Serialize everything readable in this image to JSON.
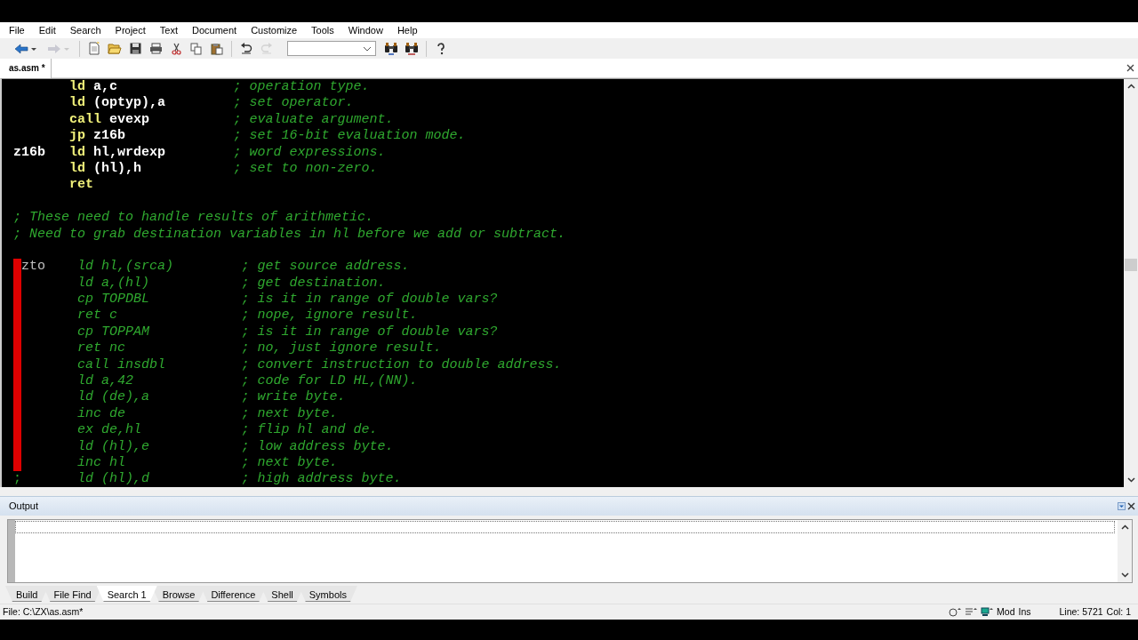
{
  "menu": [
    "File",
    "Edit",
    "Search",
    "Project",
    "Text",
    "Document",
    "Customize",
    "Tools",
    "Window",
    "Help"
  ],
  "toolbar": [
    {
      "kind": "back",
      "disabled": false
    },
    {
      "kind": "forward",
      "disabled": true
    },
    {
      "kind": "sep"
    },
    {
      "kind": "new",
      "disabled": false
    },
    {
      "kind": "open",
      "disabled": false
    },
    {
      "kind": "save",
      "disabled": false
    },
    {
      "kind": "print",
      "disabled": false
    },
    {
      "kind": "cut",
      "disabled": false
    },
    {
      "kind": "copy",
      "disabled": false
    },
    {
      "kind": "paste",
      "disabled": false
    },
    {
      "kind": "sep"
    },
    {
      "kind": "undo",
      "disabled": false
    },
    {
      "kind": "redo",
      "disabled": true
    },
    {
      "kind": "combo"
    },
    {
      "kind": "find",
      "disabled": false
    },
    {
      "kind": "replace",
      "disabled": false
    },
    {
      "kind": "sep"
    },
    {
      "kind": "help",
      "disabled": false
    }
  ],
  "document_tabs": [
    {
      "label": "as.asm *",
      "selected": true
    }
  ],
  "editor": {
    "lines": [
      {
        "kind": "code",
        "op": "ld",
        "args": "a,c",
        "comment": "; operation type."
      },
      {
        "kind": "code",
        "op": "ld",
        "args": "(optyp),a",
        "comment": "; set operator."
      },
      {
        "kind": "code",
        "op": "call",
        "args": "evexp",
        "comment": "; evaluate argument."
      },
      {
        "kind": "code",
        "op": "jp",
        "args": "z16b",
        "comment": "; set 16-bit evaluation mode."
      },
      {
        "kind": "code",
        "label": "z16b",
        "op": "ld",
        "args": "hl,wrdexp",
        "comment": "; word expressions."
      },
      {
        "kind": "code",
        "op": "ld",
        "args": "(hl),h",
        "comment": "; set to non-zero."
      },
      {
        "kind": "code",
        "op": "ret"
      },
      {
        "kind": "blank"
      },
      {
        "kind": "comment",
        "text": "; These need to handle results of arithmetic."
      },
      {
        "kind": "comment",
        "text": "; Need to grab destination variables in hl before we add or subtract."
      },
      {
        "kind": "blank"
      },
      {
        "kind": "dimmed",
        "marked": true,
        "label": "zto",
        "op": "ld",
        "args": "hl,(srca)",
        "comment": "; get source address."
      },
      {
        "kind": "dimmed",
        "marked": true,
        "op": "ld",
        "args": "a,(hl)",
        "comment": "; get destination."
      },
      {
        "kind": "dimmed",
        "marked": true,
        "op": "cp",
        "args": "TOPDBL",
        "comment": "; is it in range of double vars?"
      },
      {
        "kind": "dimmed",
        "marked": true,
        "op": "ret",
        "args": "c",
        "comment": "; nope, ignore result."
      },
      {
        "kind": "dimmed",
        "marked": true,
        "op": "cp",
        "args": "TOPPAM",
        "comment": "; is it in range of double vars?"
      },
      {
        "kind": "dimmed",
        "marked": true,
        "op": "ret",
        "args": "nc",
        "comment": "; no, just ignore result."
      },
      {
        "kind": "dimmed",
        "marked": true,
        "op": "call",
        "args": "insdbl",
        "comment": "; convert instruction to double address."
      },
      {
        "kind": "dimmed",
        "marked": true,
        "op": "ld",
        "args": "a,42",
        "comment": "; code for LD HL,(NN)."
      },
      {
        "kind": "dimmed",
        "marked": true,
        "op": "ld",
        "args": "(de),a",
        "comment": "; write byte."
      },
      {
        "kind": "dimmed",
        "marked": true,
        "op": "inc",
        "args": "de",
        "comment": "; next byte."
      },
      {
        "kind": "dimmed",
        "marked": true,
        "op": "ex",
        "args": "de,hl",
        "comment": "; flip hl and de."
      },
      {
        "kind": "dimmed",
        "marked": true,
        "op": "ld",
        "args": "(hl),e",
        "comment": "; low address byte."
      },
      {
        "kind": "dimmed",
        "marked": true,
        "op": "inc",
        "args": "hl",
        "comment": "; next byte."
      },
      {
        "kind": "dimmed",
        "marked": false,
        "gutter": ";",
        "op": "ld",
        "args": "(hl),d",
        "comment": "; high address byte."
      }
    ]
  },
  "output": {
    "title": "Output"
  },
  "output_tabs": [
    {
      "label": "Build",
      "selected": false
    },
    {
      "label": "File Find",
      "selected": false
    },
    {
      "label": "Search 1",
      "selected": true
    },
    {
      "label": "Browse",
      "selected": false
    },
    {
      "label": "Difference",
      "selected": false
    },
    {
      "label": "Shell",
      "selected": false
    },
    {
      "label": "Symbols",
      "selected": false
    }
  ],
  "status_bar": {
    "file": "File: C:\\ZX\\as.asm*",
    "mod": "Mod",
    "ins": "Ins",
    "line": "Line: 5721",
    "col": "Col: 1"
  }
}
